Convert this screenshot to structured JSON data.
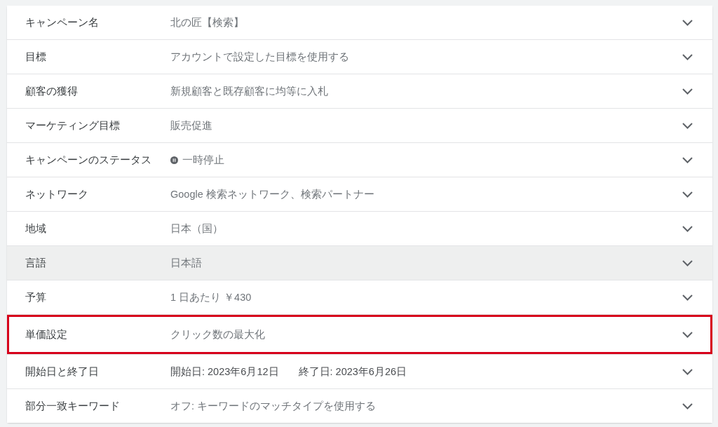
{
  "rows": [
    {
      "kind": "text",
      "label": "キャンペーン名",
      "value": "北の匠【検索】",
      "highlighted": false,
      "outlined": false
    },
    {
      "kind": "text",
      "label": "目標",
      "value": "アカウントで設定した目標を使用する",
      "highlighted": false,
      "outlined": false
    },
    {
      "kind": "text",
      "label": "顧客の獲得",
      "value": "新規顧客と既存顧客に均等に入札",
      "highlighted": false,
      "outlined": false
    },
    {
      "kind": "text",
      "label": "マーケティング目標",
      "value": "販売促進",
      "highlighted": false,
      "outlined": false
    },
    {
      "kind": "status",
      "label": "キャンペーンのステータス",
      "value": "一時停止",
      "highlighted": false,
      "outlined": false
    },
    {
      "kind": "text",
      "label": "ネットワーク",
      "value": "Google 検索ネットワーク、検索パートナー",
      "highlighted": false,
      "outlined": false
    },
    {
      "kind": "text",
      "label": "地域",
      "value": "日本（国）",
      "highlighted": false,
      "outlined": false
    },
    {
      "kind": "text",
      "label": "言語",
      "value": "日本語",
      "highlighted": true,
      "outlined": false
    },
    {
      "kind": "text",
      "label": "予算",
      "value": "1 日あたり ￥430",
      "highlighted": false,
      "outlined": false
    },
    {
      "kind": "text",
      "label": "単価設定",
      "value": "クリック数の最大化",
      "highlighted": false,
      "outlined": true
    },
    {
      "kind": "dates",
      "label": "開始日と終了日",
      "values": [
        "開始日: 2023年6月12日",
        "終了日: 2023年6月26日"
      ],
      "highlighted": false,
      "outlined": false
    },
    {
      "kind": "text",
      "label": "部分一致キーワード",
      "value": "オフ: キーワードのマッチタイプを使用する",
      "highlighted": false,
      "outlined": false
    }
  ]
}
